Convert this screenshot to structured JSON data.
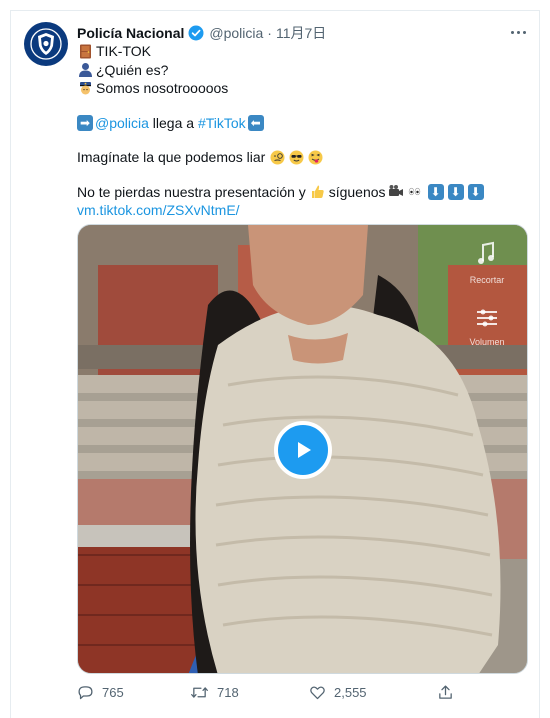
{
  "tweet": {
    "name": "Policía Nacional",
    "handle": "@policia",
    "separator": "·",
    "date": "11月7日",
    "lines": {
      "l1": "TIK-TOK",
      "l2": "¿Quién es?",
      "l3": "Somos nosotrooooos",
      "l4_link": "@policia",
      "l4_text": " llega a ",
      "l4_hashtag": "#TikTok",
      "l5": "Imagínate la que podemos liar",
      "l6_text": "No te pierdas nuestra presentación y ",
      "l6_sig": "síguenos",
      "url": "vm.tiktok.com/ZSXvNtmE/"
    }
  },
  "video": {
    "overlay_recortar": "Recortar",
    "overlay_volumen": "Volumen"
  },
  "actions": {
    "replies": "765",
    "retweets": "718",
    "likes": "2,555"
  },
  "colors": {
    "accent": "#1d9bf0",
    "link": "#1b95e0",
    "muted": "#536471"
  },
  "icons": [
    "shield-icon",
    "verified-icon",
    "more-icon",
    "door-icon",
    "silhouette-icon",
    "police-officer-icon",
    "arrow-right-icon",
    "arrow-left-icon",
    "monocle-face-icon",
    "sunglasses-face-icon",
    "tongue-face-icon",
    "thumbs-up-icon",
    "video-camera-icon",
    "eyes-icon",
    "arrow-down-icon",
    "play-icon",
    "reply-icon",
    "retweet-icon",
    "like-icon",
    "share-icon"
  ]
}
